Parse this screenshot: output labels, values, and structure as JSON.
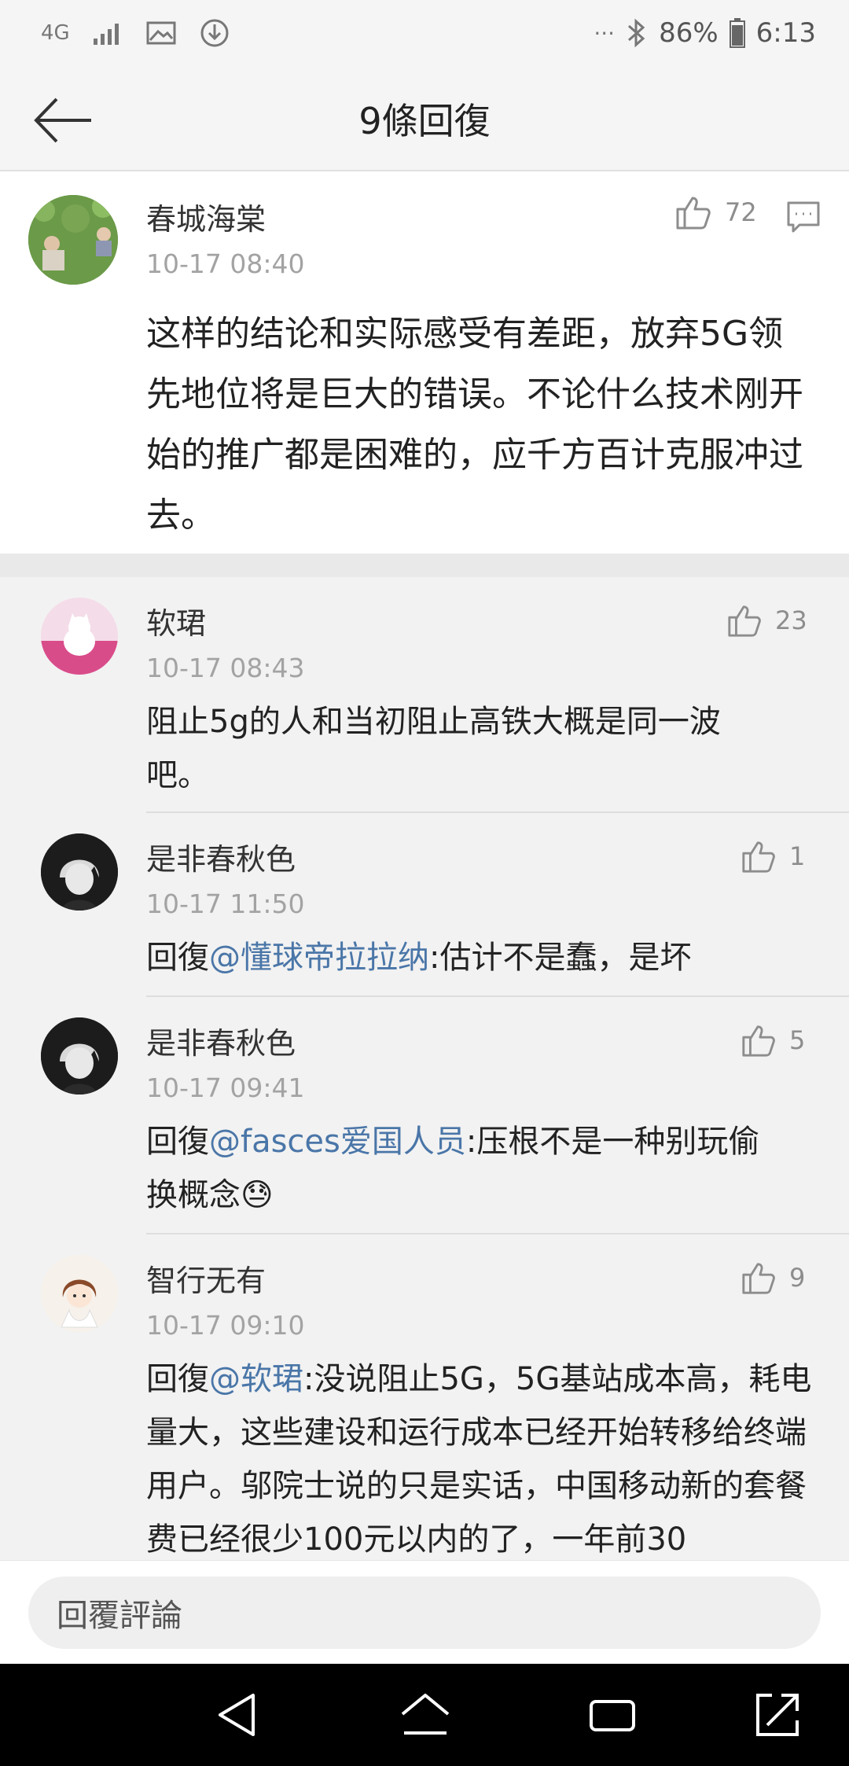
{
  "status_bar": {
    "network": "4G",
    "battery": "86%",
    "time": "6:13"
  },
  "header": {
    "title": "9條回復"
  },
  "main_comment": {
    "author": "春城海棠",
    "time": "10-17 08:40",
    "likes": "72",
    "text": "这样的结论和实际感受有差距，放弃5G领先地位将是巨大的错误。不论什么技术刚开始的推广都是困难的，应千方百计克服冲过去。"
  },
  "replies": [
    {
      "author": "软珺",
      "time": "10-17 08:43",
      "likes": "23",
      "prefix": "",
      "mention": "",
      "text": "阻止5g的人和当初阻止高铁大概是同一波吧。"
    },
    {
      "author": "是非春秋色",
      "time": "10-17 11:50",
      "likes": "1",
      "prefix": "回復",
      "mention": "@懂球帝拉拉纳",
      "text": ":估计不是蠢，是坏"
    },
    {
      "author": "是非春秋色",
      "time": "10-17 09:41",
      "likes": "5",
      "prefix": "回復",
      "mention": "@fasces爱国人员",
      "text": ":压根不是一种别玩偷换概念😓"
    },
    {
      "author": "智行无有",
      "time": "10-17 09:10",
      "likes": "9",
      "prefix": "回復",
      "mention": "@软珺",
      "text": ":没说阻止5G，5G基站成本高，耗电量大，这些建设和运行成本已经开始转移给终端用户。邬院士说的只是实话，中国移动新的套餐费已经很少100元以内的了，一年前30"
    }
  ],
  "input": {
    "placeholder": "回覆評論"
  },
  "colors": {
    "mention": "#4a76a8",
    "background": "#f2f2f2"
  }
}
